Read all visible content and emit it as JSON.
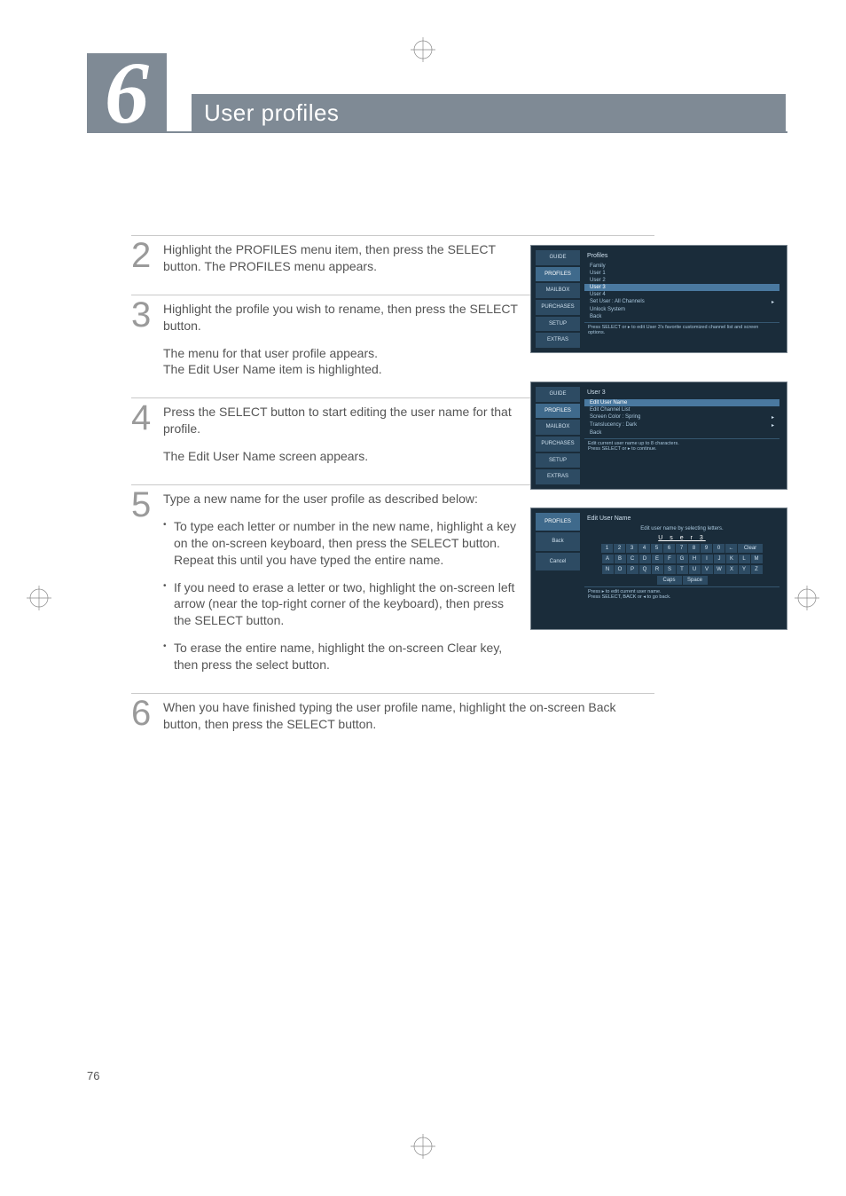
{
  "chapter": {
    "number": "6",
    "title": "User profiles"
  },
  "page_number": "76",
  "steps": [
    {
      "num": "2",
      "paragraphs": [
        "Highlight the PROFILES menu item, then press the SELECT button. The PROFILES menu appears."
      ]
    },
    {
      "num": "3",
      "paragraphs": [
        "Highlight the profile you wish to rename, then press the SELECT button.",
        "The menu for that user profile appears.\nThe Edit User Name item is highlighted."
      ]
    },
    {
      "num": "4",
      "paragraphs": [
        "Press the SELECT button to start editing the user name for that profile.",
        "The Edit User Name screen appears."
      ]
    },
    {
      "num": "5",
      "paragraphs": [
        "Type a new name for the user profile as described below:"
      ],
      "bullets": [
        "To type each letter or number in the new name, highlight a key on the on-screen keyboard, then press the SELECT button. Repeat this until you have typed the entire name.",
        "If you need to erase a letter or two, highlight the on-screen left arrow (near the top-right corner of the keyboard), then press the SELECT button.",
        "To erase the entire name, highlight the on-screen Clear key, then press the select button."
      ]
    },
    {
      "num": "6",
      "wide": true,
      "paragraphs": [
        "When you have finished typing the user profile name, highlight the on-screen Back button, then press the SELECT button."
      ]
    }
  ],
  "figures": {
    "fig1": {
      "tabs": [
        "GUIDE",
        "PROFILES",
        "MAILBOX",
        "PURCHASES",
        "SETUP",
        "EXTRAS"
      ],
      "active_tab": "PROFILES",
      "header": "Profiles",
      "rows": [
        "Family",
        "User 1",
        "User 2",
        "User 4"
      ],
      "highlight": "User 3",
      "extra_rows": [
        {
          "label": "Set User : All Channels",
          "chev": true
        },
        {
          "label": "Unlock System",
          "chev": false
        },
        {
          "label": "Back",
          "chev": false
        }
      ],
      "footer": "Press SELECT or ▸ to edit User 3's favorite customized channel list and screen options."
    },
    "fig2": {
      "tabs": [
        "GUIDE",
        "PROFILES",
        "MAILBOX",
        "PURCHASES",
        "SETUP",
        "EXTRAS"
      ],
      "active_tab": "PROFILES",
      "header": "User 3",
      "highlight": "Edit User Name",
      "rows_after": [
        {
          "label": "Edit Channel List",
          "chev": false
        },
        {
          "label": "Screen Color : Spring",
          "chev": true
        },
        {
          "label": "Translucency : Dark",
          "chev": true
        },
        {
          "label": "Back",
          "chev": false
        }
      ],
      "footer": "Edit current user name up to 8 characters.\nPress SELECT or ▸ to continue."
    },
    "fig3": {
      "tabs": [
        "PROFILES",
        "Back",
        "Cancel"
      ],
      "header": "Edit User Name",
      "hint": "Edit user name by selecting letters.",
      "input_value": "U s e r   3",
      "keys_row1": [
        "1",
        "2",
        "3",
        "4",
        "5",
        "6",
        "7",
        "8",
        "9",
        "0",
        "←",
        "Clear"
      ],
      "keys_row2": [
        "A",
        "B",
        "C",
        "D",
        "E",
        "F",
        "G",
        "H",
        "I",
        "J",
        "K",
        "L",
        "M"
      ],
      "keys_row3": [
        "N",
        "O",
        "P",
        "Q",
        "R",
        "S",
        "T",
        "U",
        "V",
        "W",
        "X",
        "Y",
        "Z"
      ],
      "keys_row4": [
        "Caps",
        "Space"
      ],
      "footer": "Press ▸ to edit current user name.\nPress SELECT, BACK or ◂ to go back."
    }
  }
}
